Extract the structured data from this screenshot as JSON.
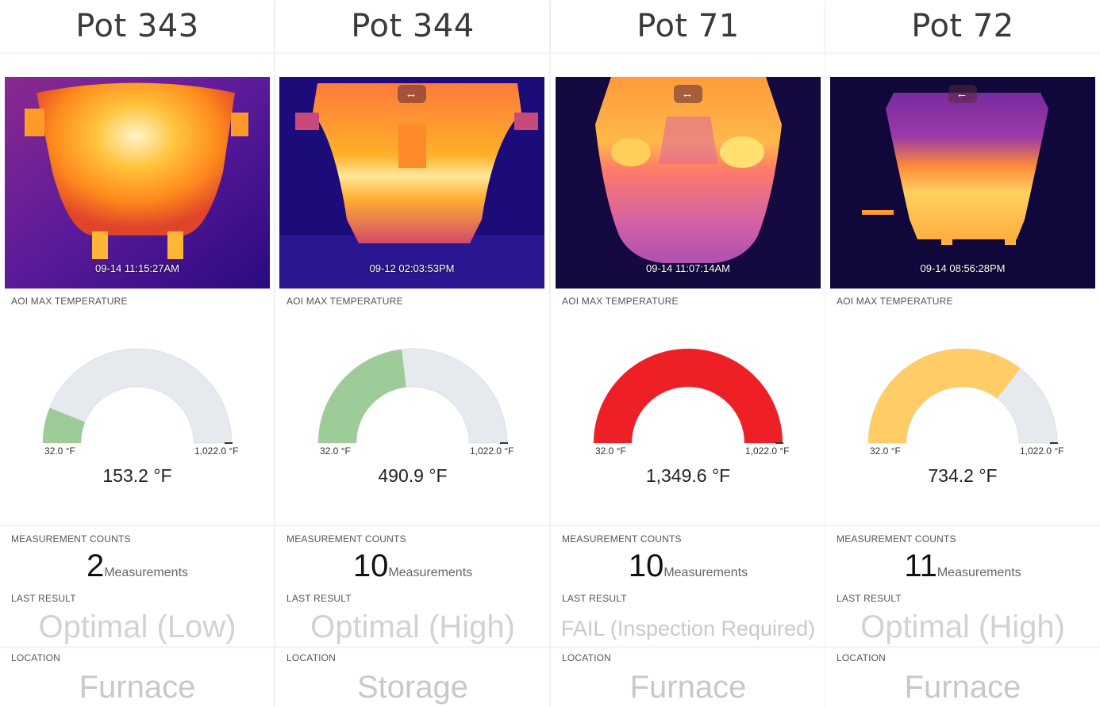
{
  "labels": {
    "aoi": "AOI MAX TEMPERATURE",
    "counts": "MEASUREMENT COUNTS",
    "last_result": "LAST RESULT",
    "location": "LOCATION"
  },
  "colors": {
    "gauge_track": "#e6e9ed",
    "optimal_low": "#9dcc98",
    "optimal_high_green": "#9dcc98",
    "optimal_high_amber": "#ffcc66",
    "fail": "#ee2025"
  },
  "pots": [
    {
      "name": "Pot 343",
      "timestamp": "09-14 11:15:27AM",
      "nav_icon": "double-arrow-icon",
      "nav_label": "",
      "gauge": {
        "min_label": "32.0 °F",
        "max_label": "1,022.0 °F",
        "value_label": "153.2 °F",
        "fraction": 0.122,
        "color": "#9dcc98"
      },
      "count": "2",
      "count_unit": "Measurements",
      "last_result": "Optimal (Low)",
      "location": "Furnace"
    },
    {
      "name": "Pot 344",
      "timestamp": "09-12 02:03:53PM",
      "nav_icon": "double-arrow-icon",
      "nav_label": "↔",
      "gauge": {
        "min_label": "32.0 °F",
        "max_label": "1,022.0 °F",
        "value_label": "490.9 °F",
        "fraction": 0.463,
        "color": "#9dcc98"
      },
      "count": "10",
      "count_unit": "Measurements",
      "last_result": "Optimal (High)",
      "location": "Storage"
    },
    {
      "name": "Pot 71",
      "timestamp": "09-14 11:07:14AM",
      "nav_icon": "double-arrow-icon",
      "nav_label": "↔",
      "gauge": {
        "min_label": "32.0 °F",
        "max_label": "1,022.0 °F",
        "value_label": "1,349.6 °F",
        "fraction": 1.0,
        "color": "#ee2025"
      },
      "count": "10",
      "count_unit": "Measurements",
      "last_result": "FAIL (Inspection Required)",
      "location": "Furnace"
    },
    {
      "name": "Pot 72",
      "timestamp": "09-14 08:56:28PM",
      "nav_icon": "left-arrow-icon",
      "nav_label": "←",
      "gauge": {
        "min_label": "32.0 °F",
        "max_label": "1,022.0 °F",
        "value_label": "734.2 °F",
        "fraction": 0.709,
        "color": "#ffcc66"
      },
      "count": "11",
      "count_unit": "Measurements",
      "last_result": "Optimal (High)",
      "location": "Furnace"
    }
  ]
}
